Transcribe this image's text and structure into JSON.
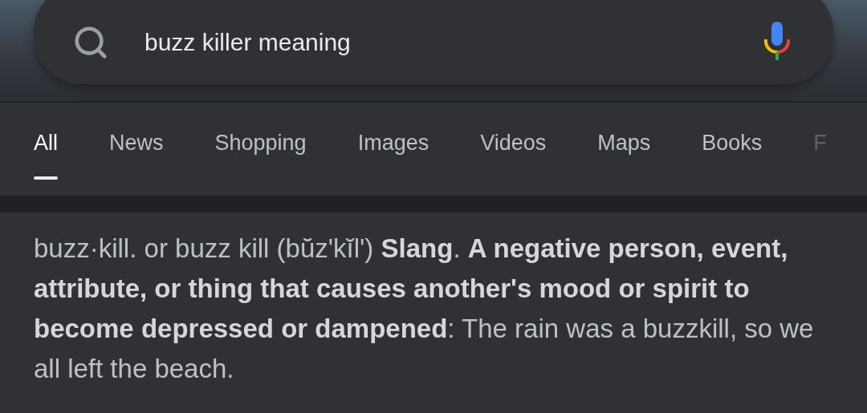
{
  "search": {
    "value": "buzz killer meaning"
  },
  "tabs": [
    {
      "label": "All",
      "selected": true
    },
    {
      "label": "News",
      "selected": false
    },
    {
      "label": "Shopping",
      "selected": false
    },
    {
      "label": "Images",
      "selected": false
    },
    {
      "label": "Videos",
      "selected": false
    },
    {
      "label": "Maps",
      "selected": false
    },
    {
      "label": "Books",
      "selected": false
    },
    {
      "label": "F",
      "selected": false,
      "faded": true
    }
  ],
  "definition": "buzz·kill. or buzz kill (bŭz'kĭl') **Slang**. **A negative person, event, attribute, or thing that causes another's mood or spirit to become depressed or dampened**: The rain was a buzzkill, so we all left the beach."
}
